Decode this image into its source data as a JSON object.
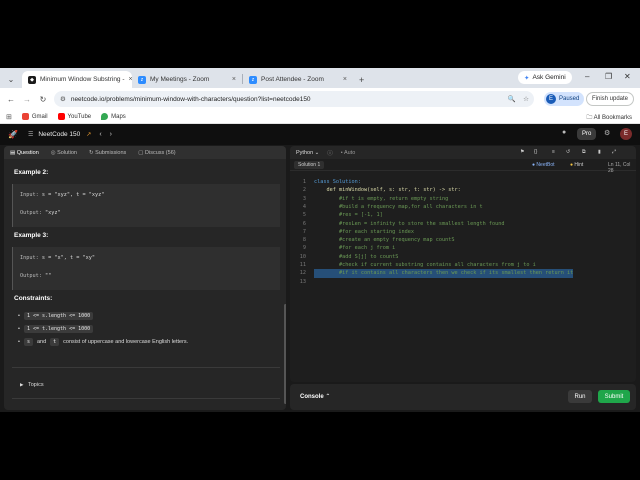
{
  "browser": {
    "tabs": [
      {
        "title": "Minimum Window Substring - ",
        "active": true
      },
      {
        "title": "My Meetings - Zoom",
        "active": false
      },
      {
        "title": "Post Attendee - Zoom",
        "active": false
      }
    ],
    "gemini_label": "Ask Gemini",
    "url": "neetcode.io/problems/minimum-window-with-characters/question?list=neetcode150",
    "profile_initial": "E",
    "profile_status": "Paused",
    "update_label": "Finish update",
    "bookmarks": [
      "Gmail",
      "YouTube",
      "Maps"
    ],
    "all_bookmarks": "All Bookmarks"
  },
  "app": {
    "list_name": "NeetCode 150",
    "pro_label": "Pro",
    "avatar_initial": "E",
    "left_tabs": [
      "Question",
      "Solution",
      "Submissions",
      "Discuss (56)"
    ],
    "example2": {
      "heading": "Example 2:",
      "input": "s = \"xyz\", t = \"xyz\"",
      "output": "\"xyz\"",
      "input_label": "Input:",
      "output_label": "Output:"
    },
    "example3": {
      "heading": "Example 3:",
      "input": "s = \"x\", t = \"xy\"",
      "output": "\"\"",
      "input_label": "Input:",
      "output_label": "Output:"
    },
    "constraints_heading": "Constraints:",
    "constraints": [
      {
        "code": "1 <= s.length <= 1000",
        "text": ""
      },
      {
        "code": "1 <= t.length <= 1000",
        "text": ""
      }
    ],
    "constraint3": {
      "code1": "s",
      "mid": "and",
      "code2": "t",
      "text": "consist of uppercase and lowercase English letters."
    },
    "topics_label": "Topics",
    "editor": {
      "language": "Python",
      "mode": "Auto",
      "solution_tab": "Solution 1",
      "neetbot": "NeetBot",
      "hint": "Hint",
      "cursor_pos": "Ln 11, Col 28"
    },
    "code_lines": [
      "class Solution:",
      "    def minWindow(self, s: str, t: str) -> str:",
      "        #if t is empty, return empty string",
      "        #build a frequency map,for all characters in t",
      "        #res = [-1, 1]",
      "        #resLen = infinity to store the smallest length found",
      "        #for each starting index",
      "        #create an empty frequency map countS",
      "        #for each j from i",
      "        #add S[j] to countS",
      "        #check if current substring contains all characters from j to i",
      "        #if it contains all characters then we check if its smallest then return it",
      ""
    ],
    "console_label": "Console",
    "run_label": "Run",
    "submit_label": "Submit"
  }
}
